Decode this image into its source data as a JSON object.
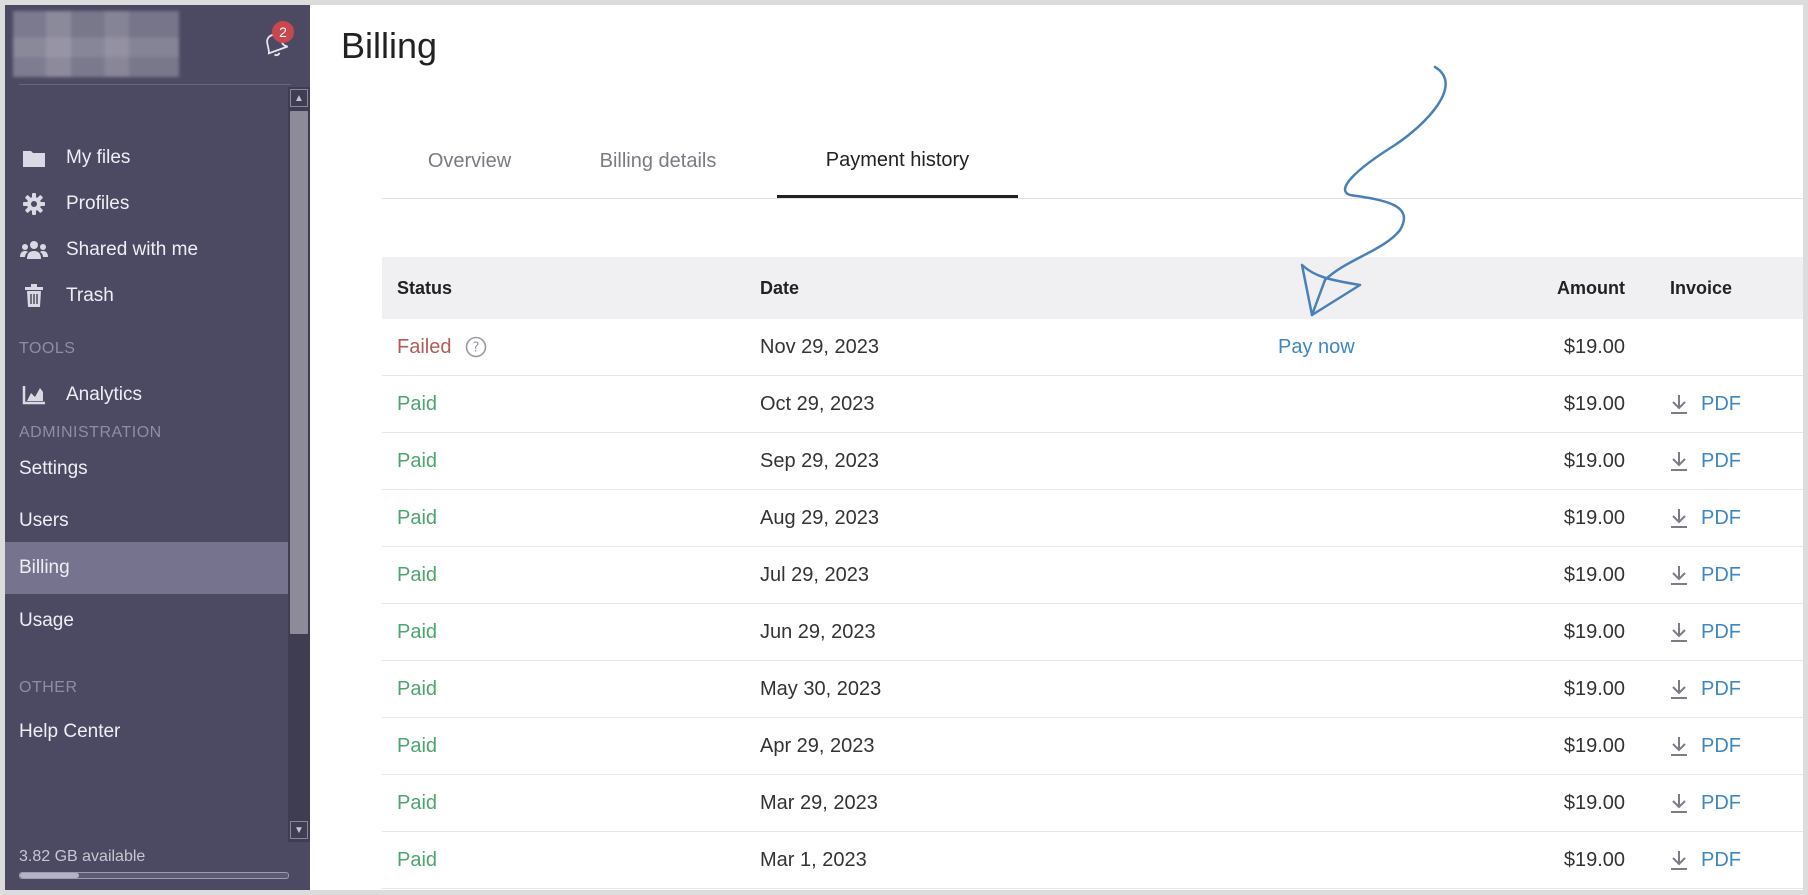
{
  "notifications": {
    "count": "2"
  },
  "sidebar": {
    "items": [
      {
        "label": "My files",
        "icon": "folder-icon"
      },
      {
        "label": "Profiles",
        "icon": "gear-icon"
      },
      {
        "label": "Shared with me",
        "icon": "users-icon"
      },
      {
        "label": "Trash",
        "icon": "trash-icon"
      }
    ],
    "tools_section": "TOOLS",
    "tools": [
      {
        "label": "Analytics",
        "icon": "chart-icon"
      }
    ],
    "admin_section": "ADMINISTRATION",
    "admin": [
      {
        "label": "Settings"
      },
      {
        "label": "Users"
      },
      {
        "label": "Billing",
        "active": true
      },
      {
        "label": "Usage"
      }
    ],
    "other_section": "OTHER",
    "other": [
      {
        "label": "Help Center"
      }
    ],
    "storage": {
      "label": "3.82 GB available",
      "used_fraction": 0.22
    }
  },
  "page": {
    "title": "Billing"
  },
  "tabs": [
    {
      "label": "Overview",
      "active": false
    },
    {
      "label": "Billing details",
      "active": false
    },
    {
      "label": "Payment history",
      "active": true
    }
  ],
  "table": {
    "headers": {
      "status": "Status",
      "date": "Date",
      "amount": "Amount",
      "invoice": "Invoice"
    },
    "rows": [
      {
        "status": "Failed",
        "date": "Nov 29, 2023",
        "amount": "$19.00",
        "action": "Pay now",
        "invoice": ""
      },
      {
        "status": "Paid",
        "date": "Oct 29, 2023",
        "amount": "$19.00",
        "action": "",
        "invoice": "PDF"
      },
      {
        "status": "Paid",
        "date": "Sep 29, 2023",
        "amount": "$19.00",
        "action": "",
        "invoice": "PDF"
      },
      {
        "status": "Paid",
        "date": "Aug 29, 2023",
        "amount": "$19.00",
        "action": "",
        "invoice": "PDF"
      },
      {
        "status": "Paid",
        "date": "Jul 29, 2023",
        "amount": "$19.00",
        "action": "",
        "invoice": "PDF"
      },
      {
        "status": "Paid",
        "date": "Jun 29, 2023",
        "amount": "$19.00",
        "action": "",
        "invoice": "PDF"
      },
      {
        "status": "Paid",
        "date": "May 30, 2023",
        "amount": "$19.00",
        "action": "",
        "invoice": "PDF"
      },
      {
        "status": "Paid",
        "date": "Apr 29, 2023",
        "amount": "$19.00",
        "action": "",
        "invoice": "PDF"
      },
      {
        "status": "Paid",
        "date": "Mar 29, 2023",
        "amount": "$19.00",
        "action": "",
        "invoice": "PDF"
      },
      {
        "status": "Paid",
        "date": "Mar 1, 2023",
        "amount": "$19.00",
        "action": "",
        "invoice": "PDF"
      }
    ]
  },
  "colors": {
    "sidebar_bg": "#4c4a63",
    "active_item": "#75738d",
    "failed": "#b05c59",
    "paid": "#4ca56e",
    "link": "#3e87c2",
    "badge": "#c9484e",
    "annotation_arrow": "#4a80b8"
  }
}
